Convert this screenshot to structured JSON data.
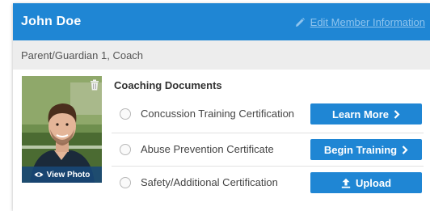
{
  "member": {
    "name": "John Doe",
    "edit_label": "Edit Member Information",
    "roles": "Parent/Guardian 1, Coach"
  },
  "photo": {
    "view_label": "View Photo",
    "icons": [
      "trash-icon",
      "eye-icon"
    ]
  },
  "documents": {
    "title": "Coaching Documents",
    "items": [
      {
        "label": "Concussion Training Certification",
        "button": "Learn More",
        "button_icon": "chevron-right-icon"
      },
      {
        "label": "Abuse Prevention Certificate",
        "button": "Begin Training",
        "button_icon": "chevron-right-icon"
      },
      {
        "label": "Safety/Additional Certification",
        "button": "Upload",
        "button_icon": "upload-icon"
      }
    ]
  },
  "colors": {
    "header_bg": "#1f86d4",
    "button_bg": "#1f86d4",
    "edit_link": "#8fc4ee",
    "roles_bg": "#ededed"
  }
}
